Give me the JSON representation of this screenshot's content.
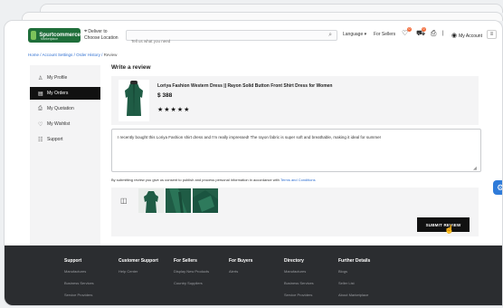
{
  "header": {
    "logo_name": "Spurtcommerce",
    "logo_sub": "Marketplace",
    "deliver_line1": "Deliver to",
    "deliver_line2": "Choose Location",
    "search_placeholder": "Tell us what you need",
    "language": "Language ▾",
    "for_sellers": "For Sellers",
    "wishlist_count": "0",
    "cart_count": "0",
    "account": "My Account"
  },
  "breadcrumb": {
    "home": "Home",
    "account_settings": "Account Settings",
    "order_history": "Order History",
    "current": "Review"
  },
  "sidebar": {
    "items": [
      {
        "label": "My Profile",
        "icon": "user-icon"
      },
      {
        "label": "My Orders",
        "icon": "orders-icon"
      },
      {
        "label": "My Quotation",
        "icon": "quotation-icon"
      },
      {
        "label": "My Wishlist",
        "icon": "heart-icon"
      },
      {
        "label": "Support",
        "icon": "support-icon"
      }
    ]
  },
  "main": {
    "title": "Write a review",
    "product": {
      "name": "Loriya Fashion Western Dress || Rayon Solid Button Front Shirt Dress for Women",
      "price": "$ 388",
      "rating": 5,
      "stars": "★★★★★"
    },
    "review_text": "I recently bought this Loriya Fashion shirt dress and I'm really impressed! The rayon fabric is super soft and breathable, making it ideal for summer",
    "consent_text": "By submitting review you give us consent to publish and process personal information in accordance with",
    "consent_link": "Terms and Conditions",
    "submit_label": "SUBMIT REVIEW"
  },
  "footer": {
    "columns": [
      {
        "heading": "Support",
        "links": [
          "Manufactures",
          "Business Services",
          "Service Providers"
        ]
      },
      {
        "heading": "Customer Support",
        "links": [
          "Help Center"
        ]
      },
      {
        "heading": "For Sellers",
        "links": [
          "Display New Products",
          "Country Suppliers"
        ]
      },
      {
        "heading": "For Buyers",
        "links": [
          "Alerts"
        ]
      },
      {
        "heading": "Directory",
        "links": [
          "Manufactures",
          "Business Services",
          "Service Providers"
        ]
      },
      {
        "heading": "Further Details",
        "links": [
          "Blogs",
          "Seller List",
          "About Marketplace"
        ]
      }
    ]
  },
  "colors": {
    "accent_link": "#2f6fd1",
    "dress_green": "#1f5c45",
    "footer_bg": "#2b2d30",
    "active_nav": "#111111"
  }
}
